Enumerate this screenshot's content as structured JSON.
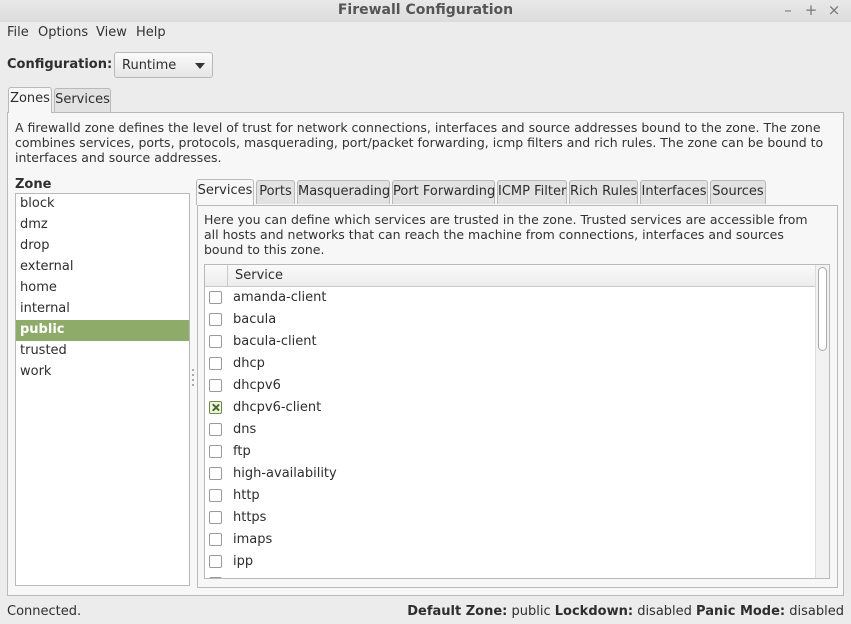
{
  "window": {
    "title": "Firewall Configuration"
  },
  "menu": {
    "items": [
      "File",
      "Options",
      "View",
      "Help"
    ]
  },
  "configuration": {
    "label": "Configuration:",
    "value": "Runtime"
  },
  "main_tabs": [
    {
      "label": "Zones",
      "active": true
    },
    {
      "label": "Services",
      "active": false
    }
  ],
  "zones_description": "A firewalld zone defines the level of trust for network connections, interfaces and source addresses bound to the zone. The zone combines services, ports, protocols, masquerading, port/packet forwarding, icmp filters and rich rules. The zone can be bound to interfaces and source addresses.",
  "zone_list": {
    "heading": "Zone",
    "items": [
      "block",
      "dmz",
      "drop",
      "external",
      "home",
      "internal",
      "public",
      "trusted",
      "work"
    ],
    "selected": "public"
  },
  "zone_tabs": [
    {
      "label": "Services",
      "active": true
    },
    {
      "label": "Ports",
      "active": false
    },
    {
      "label": "Masquerading",
      "active": false
    },
    {
      "label": "Port Forwarding",
      "active": false
    },
    {
      "label": "ICMP Filter",
      "active": false
    },
    {
      "label": "Rich Rules",
      "active": false
    },
    {
      "label": "Interfaces",
      "active": false
    },
    {
      "label": "Sources",
      "active": false
    }
  ],
  "services_description": "Here you can define which services are trusted in the zone. Trusted services are accessible from all hosts and networks that can reach the machine from connections, interfaces and sources bound to this zone.",
  "services_table": {
    "column_header": "Service",
    "rows": [
      {
        "name": "amanda-client",
        "checked": false
      },
      {
        "name": "bacula",
        "checked": false
      },
      {
        "name": "bacula-client",
        "checked": false
      },
      {
        "name": "dhcp",
        "checked": false
      },
      {
        "name": "dhcpv6",
        "checked": false
      },
      {
        "name": "dhcpv6-client",
        "checked": true
      },
      {
        "name": "dns",
        "checked": false
      },
      {
        "name": "ftp",
        "checked": false
      },
      {
        "name": "high-availability",
        "checked": false
      },
      {
        "name": "http",
        "checked": false
      },
      {
        "name": "https",
        "checked": false
      },
      {
        "name": "imaps",
        "checked": false
      },
      {
        "name": "ipp",
        "checked": false
      }
    ]
  },
  "status": {
    "connection": "Connected.",
    "default_zone_label": "Default Zone:",
    "default_zone_value": "public",
    "lockdown_label": "Lockdown:",
    "lockdown_value": "disabled",
    "panic_label": "Panic Mode:",
    "panic_value": "disabled"
  },
  "colors": {
    "selection": "#8fab6a",
    "check_accent": "#6c8a46",
    "window_bg": "#ececec"
  }
}
